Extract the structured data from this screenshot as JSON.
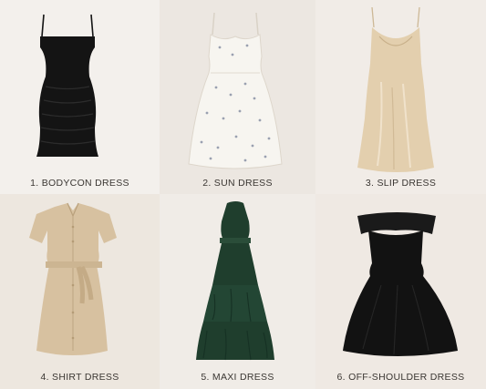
{
  "panels": [
    {
      "label": "1. BODYCON DRESS",
      "bg": "#f3f0ec",
      "dress_color": "#141414",
      "icon": "bodycon-dress-icon"
    },
    {
      "label": "2. SUN DRESS",
      "bg": "#ece7e1",
      "dress_color": "#f7f5f0",
      "icon": "sun-dress-icon"
    },
    {
      "label": "3. SLIP DRESS",
      "bg": "#f1ece7",
      "dress_color": "#e3cfae",
      "icon": "slip-dress-icon"
    },
    {
      "label": "4. SHIRT DRESS",
      "bg": "#ede7df",
      "dress_color": "#d7c1a0",
      "icon": "shirt-dress-icon"
    },
    {
      "label": "5. MAXI DRESS",
      "bg": "#f0ece7",
      "dress_color": "#1f3e2d",
      "icon": "maxi-dress-icon"
    },
    {
      "label": "6. OFF-SHOULDER DRESS",
      "bg": "#efe9e3",
      "dress_color": "#121212",
      "icon": "off-shoulder-dress-icon"
    }
  ]
}
